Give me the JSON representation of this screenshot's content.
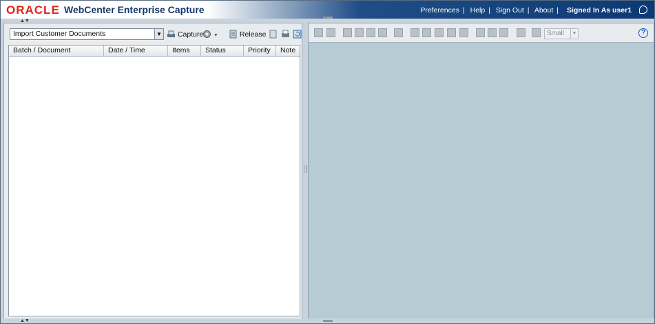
{
  "header": {
    "logo_text": "ORACLE",
    "app_title": "WebCenter Enterprise Capture",
    "nav": [
      "Preferences",
      "Help",
      "Sign Out",
      "About"
    ],
    "signed_in": "Signed In As user1"
  },
  "left_pane": {
    "client_profile": "Import Customer Documents",
    "capture_label": "Capture",
    "release_label": "Release",
    "columns": [
      "Batch / Document",
      "Date / Time",
      "Items",
      "Status",
      "Priority",
      "Note"
    ],
    "rows": []
  },
  "right_pane": {
    "thumbnail_size": "Small",
    "help_symbol": "?"
  },
  "colors": {
    "header_blue": "#0d3a73",
    "oracle_red": "#e2231a",
    "viewer_bg": "#b6cbd3"
  }
}
